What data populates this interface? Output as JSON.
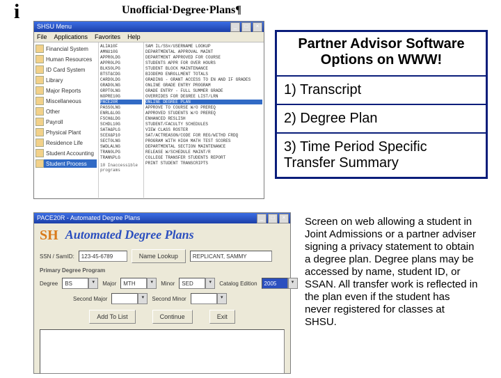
{
  "doc": {
    "letter_i": "i",
    "heading": "Unofficial·Degree·Plans¶"
  },
  "shot1": {
    "title": "SHSU Menu",
    "menubar": [
      "File",
      "Applications",
      "Favorites",
      "Help"
    ],
    "leftpane": [
      "Financial System",
      "Human Resources",
      "ID Card System",
      "Library",
      "Major Reports",
      "Miscellaneous",
      "Other",
      "Payroll",
      "Physical Plant",
      "Residence Life",
      "Student Accounting"
    ],
    "left_selected": "Student Process",
    "mid": [
      "ALIA10F",
      "AMNU10G",
      "APPR0LDG",
      "APPR0LPG",
      "BLKS0LPG",
      "BTST&CDG",
      "CARD0LDG",
      "GRAD0LNG",
      "GRPT0LNG",
      "NOPRE10G"
    ],
    "mid_selected": "PACE20R",
    "mid2": [
      "PASS0LNG",
      "ENRL&LOG",
      "FSCH&LDG",
      "SCHDL10G",
      "SATA&PLG",
      "SCEX&P10",
      "SECT0LNG",
      "SWDLALNG",
      "TRAN0LPG",
      "TRAN%PLG"
    ],
    "right": [
      "SAM IL/SS#/USERNAME LOOKUP",
      "DEPARTMENTAL APPROVAL MAINT",
      "DEPARTMENT APPROVED FOR COURSE",
      "STUDENTS APPR FOR OVER HOURS",
      "STUDENT BLOCK MAINTENANCE",
      "BIODEMO ENROLLMENT TOTALS",
      "GRADING - GRANT ACCESS TO EN AND IF GRADES",
      "ONLINE GRADE ENTRY PROGRAM",
      "GRADE ENTRY - FULL SUMMER GRADE",
      "OVERRIDES FOR DEGREE LIST/LRN"
    ],
    "right_selected": "ONLINE DEGREE PLAN",
    "right2": [
      "APPROVE TO COURSE W/O PREREQ",
      "APPROVED STUDENTS W/O PREREQ",
      "ENHANCED RESLISH",
      "STUDENT/FACULTY SCHEDULES",
      "VIEW CLASS ROSTER",
      "SAT/ACTREASON/CODE FOR REG/WITHD FRDQ",
      "PROGRAM WITH HIGH MATH TEST SCORES",
      "DEPARTMENTAL SECTION MAINTENANCE",
      "RELEASE W/SCHEDULE MAINT/R",
      "COLLEGE TRANSFER STUDENTS REPORT",
      "PRINT STUDENT TRANSCRIPTS"
    ],
    "footnotes": [
      "10 Inaccessible programs"
    ]
  },
  "callout": {
    "title": "Partner Advisor Software Options on WWW!",
    "items": [
      "1) Transcript",
      "2) Degree Plan",
      "3) Time Period Specific Transfer Summary"
    ]
  },
  "paragraph": "Screen on web allowing a student in Joint Admissions or a partner adviser signing a privacy statement to obtain a degree plan.  Degree plans may be accessed by name, student ID, or SSAN.  All transfer work is reflected in the plan even if the student has never registered for classes at SHSU.",
  "shot2": {
    "title": "PACE20R - Automated Degree Plans",
    "logo": "SH",
    "heading": "Automated Degree Plans",
    "ssn_label": "SSN / SamID:",
    "ssn_value": "123-45-6789",
    "name_lookup_btn": "Name Lookup",
    "name_value": "REPLICANT, SAMMY",
    "section_label": "Primary Degree Program",
    "degree_label": "Degree",
    "degree_value": "BS",
    "major_label": "Major",
    "major_value": "MTH",
    "minor_label": "Minor",
    "minor_value": "SED",
    "catalog_label": "Catalog Edition",
    "catalog_value": "2005",
    "second_major_label": "Second Major",
    "second_minor_label": "Second Minor",
    "btns": [
      "Add To List",
      "Continue",
      "Exit"
    ]
  }
}
